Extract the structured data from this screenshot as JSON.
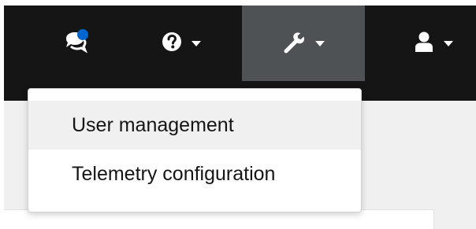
{
  "masthead": {
    "notifications_icon": "chat-bubbles-icon",
    "help_icon": "question-circle-icon",
    "tools_icon": "wrench-icon",
    "user_icon": "user-icon",
    "colors": {
      "background": "#151515",
      "active_background": "#4f5255",
      "notification_badge": "#0066cc"
    }
  },
  "tools_menu": {
    "items": [
      {
        "label": "User management"
      },
      {
        "label": "Telemetry configuration"
      }
    ]
  }
}
